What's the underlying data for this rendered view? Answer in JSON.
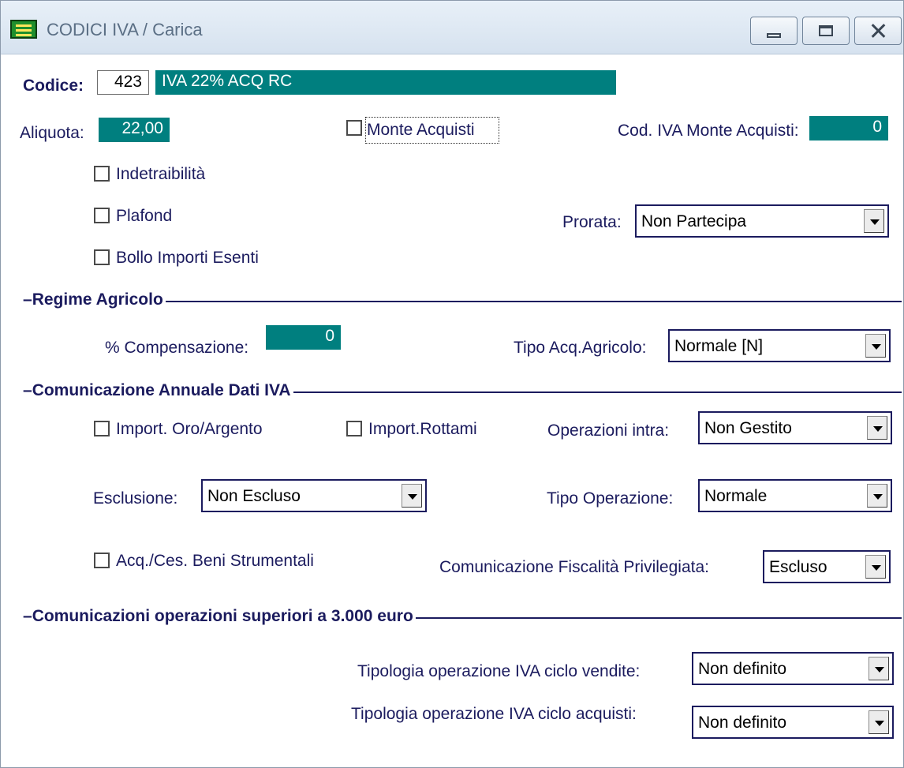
{
  "window": {
    "title": "CODICI IVA / Carica",
    "icon": "app-table-icon"
  },
  "header": {
    "codice_label": "Codice:",
    "codice_value": "423",
    "descrizione_value": "IVA 22% ACQ RC",
    "aliquota_label": "Aliquota:",
    "aliquota_value": "22,00",
    "monte_acquisti_label": "Monte Acquisti",
    "monte_acquisti_checked": false,
    "cod_iva_monte_label": "Cod. IVA Monte Acquisti:",
    "cod_iva_monte_value": "0",
    "indetraibilita_label": "Indetraibilità",
    "plafond_label": "Plafond",
    "bollo_label": "Bollo Importi Esenti",
    "prorata_label": "Prorata:",
    "prorata_value": "Non Partecipa"
  },
  "regime_agricolo": {
    "title": "Regime Agricolo",
    "compensazione_label": "% Compensazione:",
    "compensazione_value": "0",
    "tipo_acq_label": "Tipo Acq.Agricolo:",
    "tipo_acq_value": "Normale [N]"
  },
  "comunicazione_annuale": {
    "title": "Comunicazione Annuale Dati IVA",
    "oro_label": "Import. Oro/Argento",
    "rottami_label": "Import.Rottami",
    "operazioni_intra_label": "Operazioni intra:",
    "operazioni_intra_value": "Non Gestito",
    "esclusione_label": "Esclusione:",
    "esclusione_value": "Non Escluso",
    "tipo_operazione_label": "Tipo Operazione:",
    "tipo_operazione_value": "Normale",
    "beni_strumentali_label": "Acq./Ces. Beni Strumentali",
    "fiscalita_label": "Comunicazione Fiscalità Privilegiata:",
    "fiscalita_value": "Escluso"
  },
  "operazioni_superiori": {
    "title": "Comunicazioni operazioni superiori a 3.000 euro",
    "vendite_label": "Tipologia operazione IVA ciclo vendite:",
    "vendite_value": "Non definito",
    "acquisti_label": "Tipologia operazione IVA ciclo acquisti:",
    "acquisti_value": "Non definito"
  },
  "colors": {
    "label_text": "#1b1b5e",
    "teal_field": "#007f7f",
    "titlebar": "#dce6f1"
  }
}
